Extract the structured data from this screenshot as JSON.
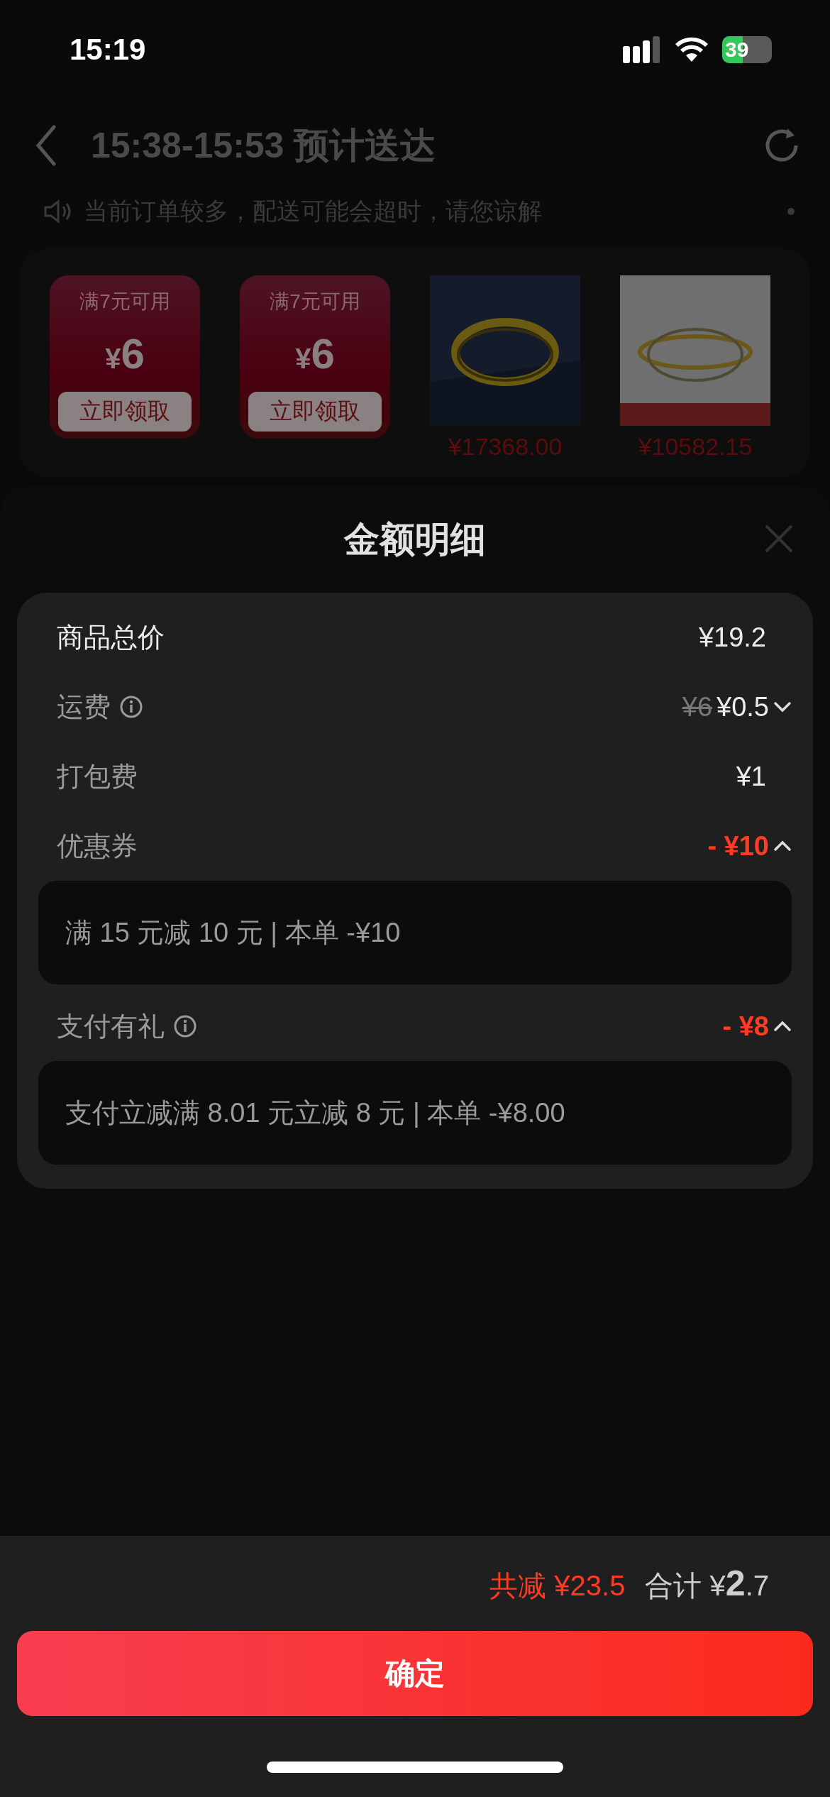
{
  "status_bar": {
    "time": "15:19",
    "battery": "39"
  },
  "header": {
    "title": "15:38-15:53 预计送达"
  },
  "notice": {
    "text": "当前订单较多，配送可能会超时，请您谅解"
  },
  "recommendations": [
    {
      "kind": "coupon",
      "condition": "满7元可用",
      "currency": "¥",
      "amount": "6",
      "action": "立即领取"
    },
    {
      "kind": "coupon",
      "condition": "满7元可用",
      "currency": "¥",
      "amount": "6",
      "action": "立即领取"
    },
    {
      "kind": "product",
      "price": "¥17368.00"
    },
    {
      "kind": "product",
      "price": "¥10582.15"
    }
  ],
  "sheet": {
    "title": "金额明细",
    "rows": [
      {
        "kind": "plain",
        "label": "商品总价",
        "primary": true,
        "info": false,
        "value": "¥19.2"
      },
      {
        "kind": "fee",
        "label": "运费",
        "primary": false,
        "info": true,
        "original_price": "¥6",
        "value": "¥0.5",
        "expanded": false
      },
      {
        "kind": "plain",
        "label": "打包费",
        "primary": false,
        "info": false,
        "value": "¥1"
      },
      {
        "kind": "discount",
        "label": "优惠券",
        "primary": false,
        "info": false,
        "value": "- ¥10",
        "expanded": true,
        "detail": "满 15 元减 10 元 | 本单 -¥10"
      },
      {
        "kind": "discount",
        "label": "支付有礼",
        "primary": false,
        "info": true,
        "value": "- ¥8",
        "expanded": true,
        "detail": "支付立减满 8.01 元立减 8 元 | 本单 -¥8.00"
      }
    ]
  },
  "footer": {
    "saved": "共减 ¥23.5",
    "total_label": "合计",
    "total_currency": "¥",
    "total_int": "2",
    "total_dec": ".7",
    "confirm": "确定"
  }
}
